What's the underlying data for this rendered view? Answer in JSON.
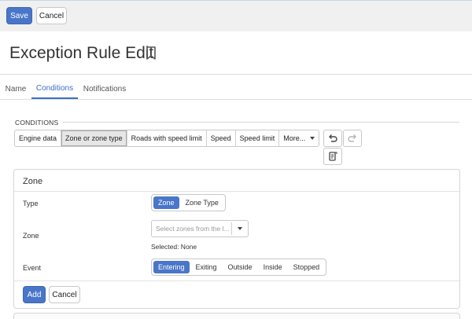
{
  "toolbar": {
    "save_label": "Save",
    "cancel_label": "Cancel"
  },
  "page": {
    "title": "Exception Rule Edit",
    "bookmark_icon": "bookmark-icon"
  },
  "tabs": [
    {
      "label": "Name",
      "active": false
    },
    {
      "label": "Conditions",
      "active": true
    },
    {
      "label": "Notifications",
      "active": false
    }
  ],
  "conditions": {
    "section_label": "CONDITIONS",
    "buttons": [
      {
        "label": "Engine data"
      },
      {
        "label": "Zone or zone type",
        "active": true
      },
      {
        "label": "Roads with speed limit"
      },
      {
        "label": "Speed"
      },
      {
        "label": "Speed limit"
      },
      {
        "label": "More..."
      }
    ],
    "icons": [
      "undo-icon",
      "redo-icon",
      "document-icon"
    ]
  },
  "zone_panel": {
    "title": "Zone",
    "type_label": "Type",
    "type_options": [
      {
        "label": "Zone",
        "active": true
      },
      {
        "label": "Zone Type",
        "active": false
      }
    ],
    "zone_label": "Zone",
    "zone_placeholder": "Select zones from the l...",
    "selected_text": "Selected: None",
    "event_label": "Event",
    "event_options": [
      {
        "label": "Entering",
        "active": true
      },
      {
        "label": "Exiting",
        "active": false
      },
      {
        "label": "Outside",
        "active": false
      },
      {
        "label": "Inside",
        "active": false
      },
      {
        "label": "Stopped",
        "active": false
      }
    ],
    "add_label": "Add",
    "cancel_label": "Cancel"
  },
  "colors": {
    "primary": "#4a76c9",
    "tab_active": "#3a6fc4"
  }
}
